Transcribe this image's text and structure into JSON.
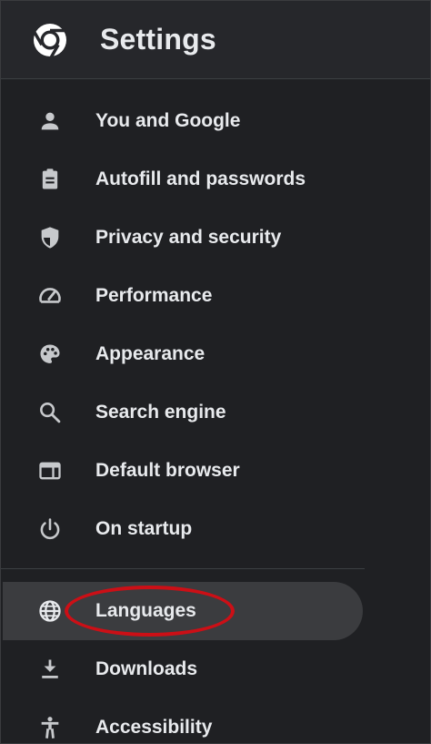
{
  "header": {
    "title": "Settings",
    "logo_icon": "chrome-logo-icon"
  },
  "nav": {
    "items": [
      {
        "label": "You and Google",
        "icon": "person-icon"
      },
      {
        "label": "Autofill and passwords",
        "icon": "clipboard-icon"
      },
      {
        "label": "Privacy and security",
        "icon": "shield-icon"
      },
      {
        "label": "Performance",
        "icon": "speedometer-icon"
      },
      {
        "label": "Appearance",
        "icon": "palette-icon"
      },
      {
        "label": "Search engine",
        "icon": "search-icon"
      },
      {
        "label": "Default browser",
        "icon": "browser-window-icon"
      },
      {
        "label": "On startup",
        "icon": "power-icon"
      },
      {
        "label": "Languages",
        "icon": "globe-icon",
        "selected": true
      },
      {
        "label": "Downloads",
        "icon": "download-icon"
      },
      {
        "label": "Accessibility",
        "icon": "accessibility-icon"
      }
    ]
  },
  "colors": {
    "background": "#1f2023",
    "header_background": "#26272b",
    "selected_item_background": "#3b3c3f",
    "text": "#e8eaed",
    "icon": "#c7c9cc",
    "annotation_circle": "#cc0f16"
  }
}
